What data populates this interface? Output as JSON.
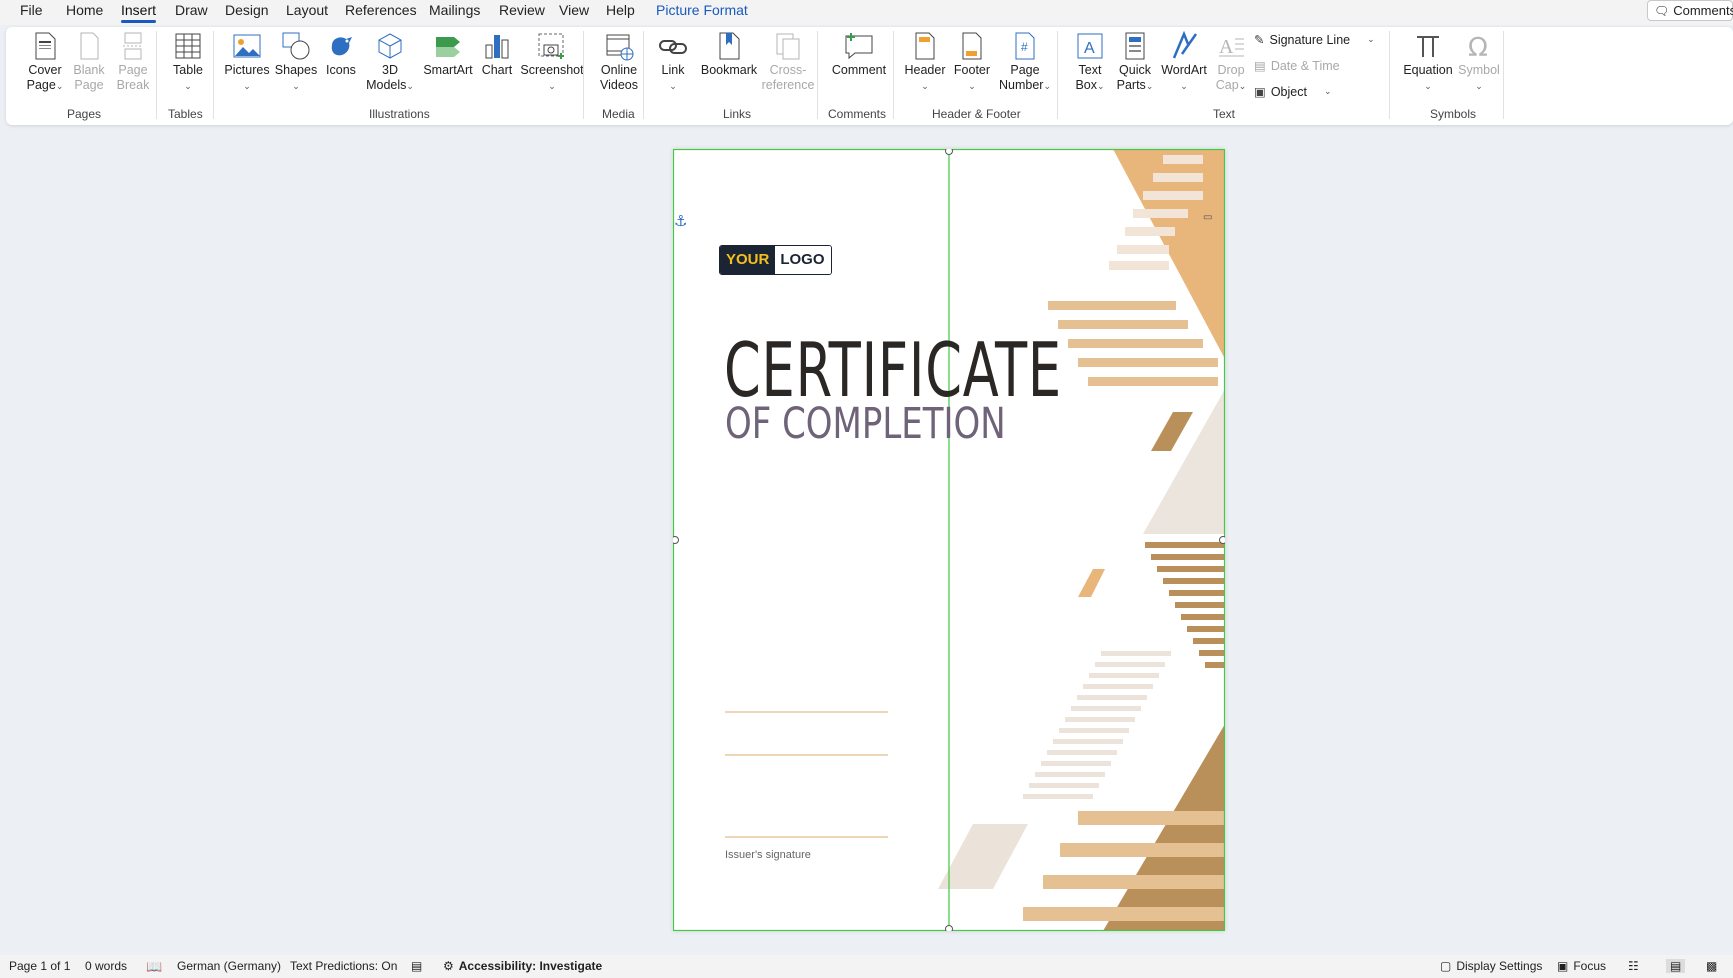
{
  "menu": {
    "tabs": [
      "File",
      "Home",
      "Insert",
      "Draw",
      "Design",
      "Layout",
      "References",
      "Mailings",
      "Review",
      "View",
      "Help",
      "Picture Format"
    ],
    "active_tab": "Insert",
    "comments_label": "Comments"
  },
  "ribbon": {
    "pages": {
      "group": "Pages",
      "cover_page": "Cover\nPage",
      "blank_page": "Blank\nPage",
      "page_break": "Page\nBreak"
    },
    "tables": {
      "group": "Tables",
      "table": "Table"
    },
    "illustrations": {
      "group": "Illustrations",
      "pictures": "Pictures",
      "shapes": "Shapes",
      "icons": "Icons",
      "models_3d": "3D\nModels",
      "smartart": "SmartArt",
      "chart": "Chart",
      "screenshot": "Screenshot"
    },
    "media": {
      "group": "Media",
      "online_videos": "Online\nVideos"
    },
    "links": {
      "group": "Links",
      "link": "Link",
      "bookmark": "Bookmark",
      "cross_reference": "Cross-\nreference"
    },
    "comments": {
      "group": "Comments",
      "comment": "Comment"
    },
    "header_footer": {
      "group": "Header & Footer",
      "header": "Header",
      "footer": "Footer",
      "page_number": "Page\nNumber"
    },
    "text": {
      "group": "Text",
      "text_box": "Text\nBox",
      "quick_parts": "Quick\nParts",
      "wordart": "WordArt",
      "drop_cap": "Drop\nCap",
      "signature_line": "Signature Line",
      "date_time": "Date & Time",
      "object": "Object"
    },
    "symbols": {
      "group": "Symbols",
      "equation": "Equation",
      "symbol": "Symbol"
    }
  },
  "document": {
    "logo_your": "YOUR",
    "logo_logo": "LOGO",
    "title": "CERTIFICATE",
    "subtitle": "OF COMPLETION",
    "signature_label": "Issuer's signature"
  },
  "colors": {
    "accent": "#185abd",
    "gold": "#e5b87a",
    "brown": "#b98f5a",
    "beige": "#e8e0d8",
    "title": "#2b2725",
    "subtitle": "#6e6378",
    "selection": "#3dcc3d",
    "logo_bg": "#1b2433",
    "logo_yellow": "#f4c01e"
  },
  "status": {
    "page": "Page 1 of 1",
    "words": "0 words",
    "language": "German (Germany)",
    "predictions": "Text Predictions: On",
    "accessibility": "Accessibility: Investigate",
    "display_settings": "Display Settings",
    "focus": "Focus"
  }
}
